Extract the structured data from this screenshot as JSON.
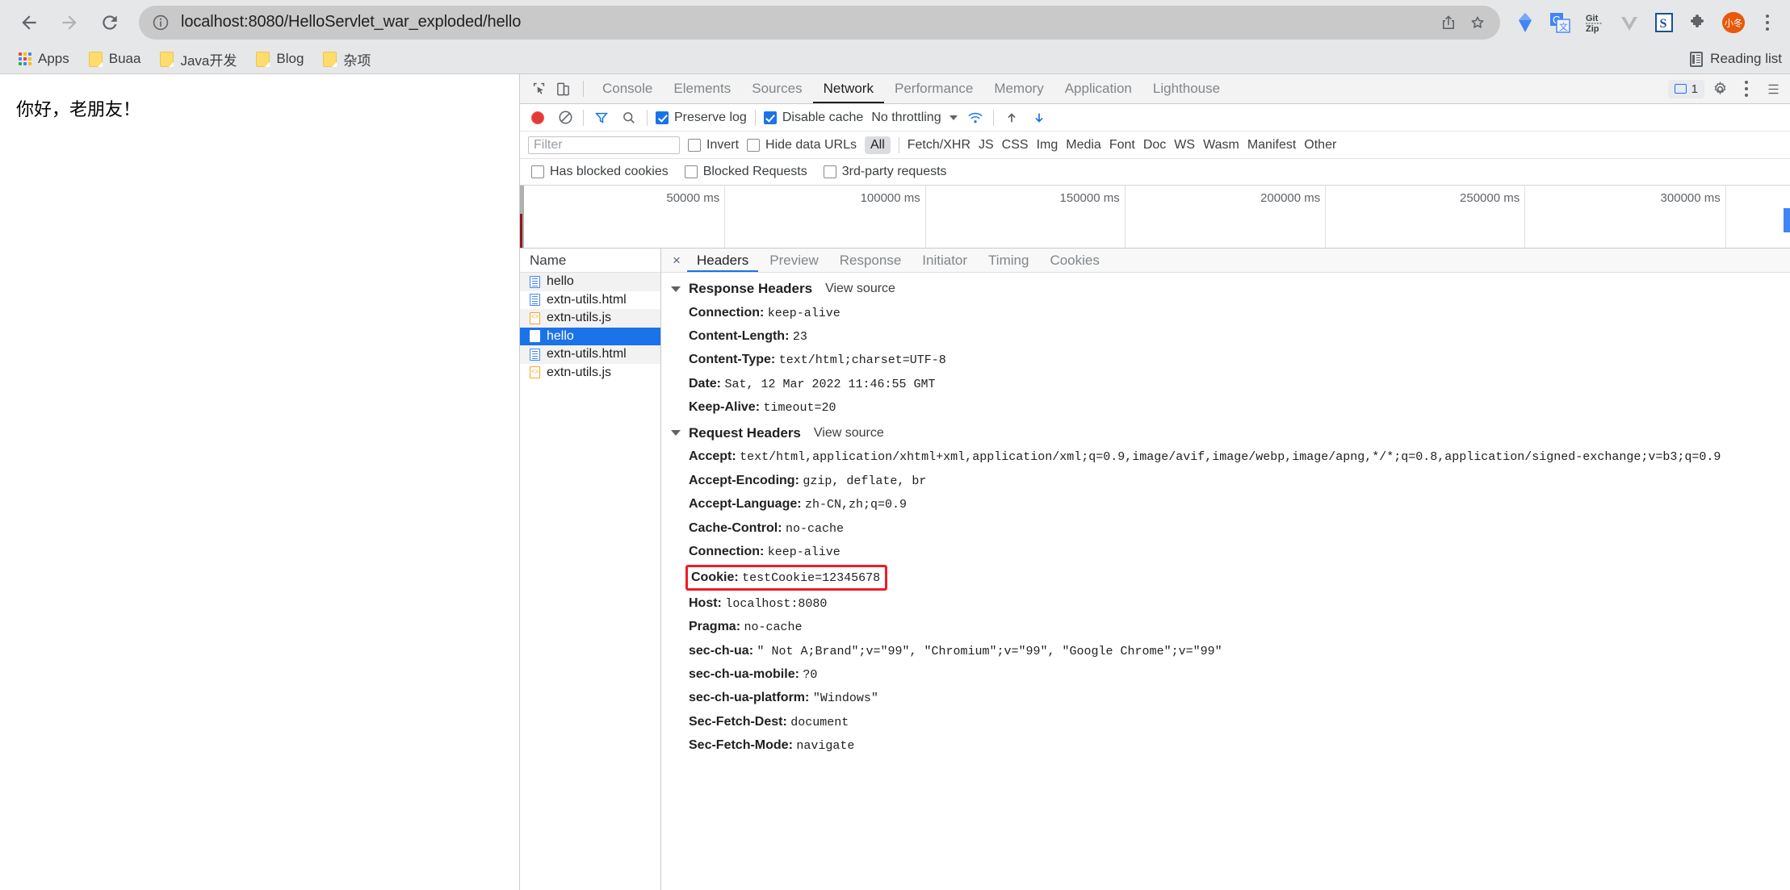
{
  "browser": {
    "nav": {
      "back": "back-arrow",
      "forward": "forward-arrow",
      "reload": "reload"
    },
    "omnibox": {
      "url": "localhost:8080/HelloServlet_war_exploded/hello",
      "info_icon": "info-circle-icon",
      "share_icon": "share-icon",
      "bookmark_icon": "star-icon"
    },
    "extensions": [
      {
        "name": "gem-extension",
        "label": ""
      },
      {
        "name": "google-translate-extension",
        "label": "G"
      },
      {
        "name": "gitzip-extension",
        "label": "Git\nZip"
      },
      {
        "name": "vue-devtools-extension",
        "label": "V"
      },
      {
        "name": "s-extension",
        "label": "S"
      },
      {
        "name": "puzzle-extensions-menu",
        "label": ""
      },
      {
        "name": "profile-avatar",
        "label": "小冬"
      }
    ],
    "menu_icon": "kebab-menu-icon"
  },
  "bookmarks": {
    "apps_label": "Apps",
    "items": [
      {
        "label": "Buaa"
      },
      {
        "label": "Java开发"
      },
      {
        "label": "Blog"
      },
      {
        "label": "杂项"
      }
    ],
    "reading_list": "Reading list"
  },
  "page": {
    "body_text": "你好，老朋友！"
  },
  "devtools": {
    "tabs": [
      {
        "label": "Console",
        "active": false
      },
      {
        "label": "Elements",
        "active": false
      },
      {
        "label": "Sources",
        "active": false
      },
      {
        "label": "Network",
        "active": true
      },
      {
        "label": "Performance",
        "active": false
      },
      {
        "label": "Memory",
        "active": false
      },
      {
        "label": "Application",
        "active": false
      },
      {
        "label": "Lighthouse",
        "active": false
      }
    ],
    "inspect_icon": "inspect-element-icon",
    "device_icon": "device-toolbar-icon",
    "issues_count": "1",
    "settings_icon": "gear-icon",
    "more_icon": "kebab-menu-icon",
    "dock_icon": "dock-side-icon",
    "controls": {
      "record_label": "record-button",
      "clear_label": "clear-button",
      "filter_label": "filter-icon",
      "search_label": "search-icon",
      "preserve_log": "Preserve log",
      "preserve_log_checked": true,
      "disable_cache": "Disable cache",
      "disable_cache_checked": true,
      "throttling": "No throttling",
      "wifi_icon": "network-conditions-icon",
      "import_icon": "import-har-icon",
      "export_icon": "export-har-icon"
    },
    "filter": {
      "placeholder": "Filter",
      "value": "",
      "invert": "Invert",
      "hide_data_urls": "Hide data URLs",
      "types": [
        "All",
        "Fetch/XHR",
        "JS",
        "CSS",
        "Img",
        "Media",
        "Font",
        "Doc",
        "WS",
        "Wasm",
        "Manifest",
        "Other"
      ],
      "active_type": "All"
    },
    "blocked": {
      "has_blocked_cookies": "Has blocked cookies",
      "blocked_requests": "Blocked Requests",
      "third_party": "3rd-party requests"
    },
    "overview": {
      "ticks": [
        "50000 ms",
        "100000 ms",
        "150000 ms",
        "200000 ms",
        "250000 ms",
        "300000 ms"
      ]
    },
    "requests": {
      "column_header": "Name",
      "rows": [
        {
          "name": "hello",
          "icon": "document-icon",
          "selected": false
        },
        {
          "name": "extn-utils.html",
          "icon": "document-icon",
          "selected": false
        },
        {
          "name": "extn-utils.js",
          "icon": "script-icon",
          "selected": false
        },
        {
          "name": "hello",
          "icon": "document-icon",
          "selected": true
        },
        {
          "name": "extn-utils.html",
          "icon": "document-icon",
          "selected": false
        },
        {
          "name": "extn-utils.js",
          "icon": "script-icon",
          "selected": false
        }
      ]
    },
    "details": {
      "close_label": "×",
      "tabs": [
        {
          "label": "Headers",
          "active": true
        },
        {
          "label": "Preview",
          "active": false
        },
        {
          "label": "Response",
          "active": false
        },
        {
          "label": "Initiator",
          "active": false
        },
        {
          "label": "Timing",
          "active": false
        },
        {
          "label": "Cookies",
          "active": false
        }
      ],
      "response_headers": {
        "title": "Response Headers",
        "view_source": "View source",
        "rows": [
          {
            "key": "Connection:",
            "value": "keep-alive"
          },
          {
            "key": "Content-Length:",
            "value": "23"
          },
          {
            "key": "Content-Type:",
            "value": "text/html;charset=UTF-8"
          },
          {
            "key": "Date:",
            "value": "Sat, 12 Mar 2022 11:46:55 GMT"
          },
          {
            "key": "Keep-Alive:",
            "value": "timeout=20"
          }
        ]
      },
      "request_headers": {
        "title": "Request Headers",
        "view_source": "View source",
        "rows": [
          {
            "key": "Accept:",
            "value": "text/html,application/xhtml+xml,application/xml;q=0.9,image/avif,image/webp,image/apng,*/*;q=0.8,application/signed-exchange;v=b3;q=0.9",
            "highlight": false
          },
          {
            "key": "Accept-Encoding:",
            "value": "gzip, deflate, br",
            "highlight": false
          },
          {
            "key": "Accept-Language:",
            "value": "zh-CN,zh;q=0.9",
            "highlight": false
          },
          {
            "key": "Cache-Control:",
            "value": "no-cache",
            "highlight": false
          },
          {
            "key": "Connection:",
            "value": "keep-alive",
            "highlight": false
          },
          {
            "key": "Cookie:",
            "value": "testCookie=12345678",
            "highlight": true
          },
          {
            "key": "Host:",
            "value": "localhost:8080",
            "highlight": false
          },
          {
            "key": "Pragma:",
            "value": "no-cache",
            "highlight": false
          },
          {
            "key": "sec-ch-ua:",
            "value": "\" Not A;Brand\";v=\"99\", \"Chromium\";v=\"99\", \"Google Chrome\";v=\"99\"",
            "highlight": false
          },
          {
            "key": "sec-ch-ua-mobile:",
            "value": "?0",
            "highlight": false
          },
          {
            "key": "sec-ch-ua-platform:",
            "value": "\"Windows\"",
            "highlight": false
          },
          {
            "key": "Sec-Fetch-Dest:",
            "value": "document",
            "highlight": false
          },
          {
            "key": "Sec-Fetch-Mode:",
            "value": "navigate",
            "highlight": false
          }
        ]
      }
    }
  },
  "colors": {
    "accent": "#1a73e8",
    "highlight_box": "#ee1c25",
    "selected_row": "#1a73e8",
    "record": "#e53935"
  }
}
